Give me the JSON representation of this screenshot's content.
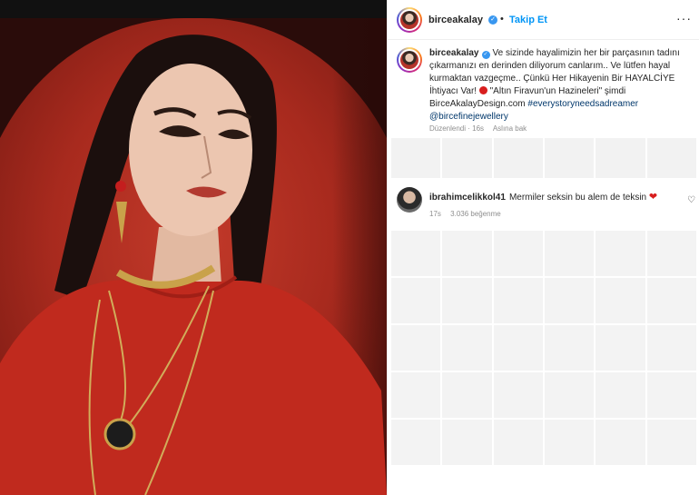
{
  "post": {
    "author": {
      "username": "birceakalay",
      "verified": true,
      "follow_label": "Takip Et",
      "separator": "•"
    },
    "more_icon": "more-horizontal-icon",
    "caption": {
      "username": "birceakalay",
      "text_1": "Ve sizinde hayalimizin her bir parçasının tadını çıkarmanızı en derinden diliyorum canlarım.. Ve lütfen hayal kurmaktan vazgeçme.. Çünkü Her Hikayenin Bir HAYALCİYE İhtiyacı Var!",
      "text_2": "\"Altın Firavun'un Hazineleri\" şimdi BirceAkalayDesign.com",
      "hashtag": "#everystoryneedsadreamer",
      "mention": "@bircefinejewellery",
      "edited_label": "Düzenlendi · 16s",
      "translate_label": "Aslına bak"
    },
    "comment": {
      "username": "ibrahimcelikkol41",
      "text": "Mermiler seksin bu alem de teksin",
      "time": "17s",
      "likes_label": "3.036 beğenme",
      "emoji": "❤"
    }
  },
  "colors": {
    "accent": "#0095f6",
    "verified": "#3897f0",
    "photo_background": "#b5332a"
  }
}
